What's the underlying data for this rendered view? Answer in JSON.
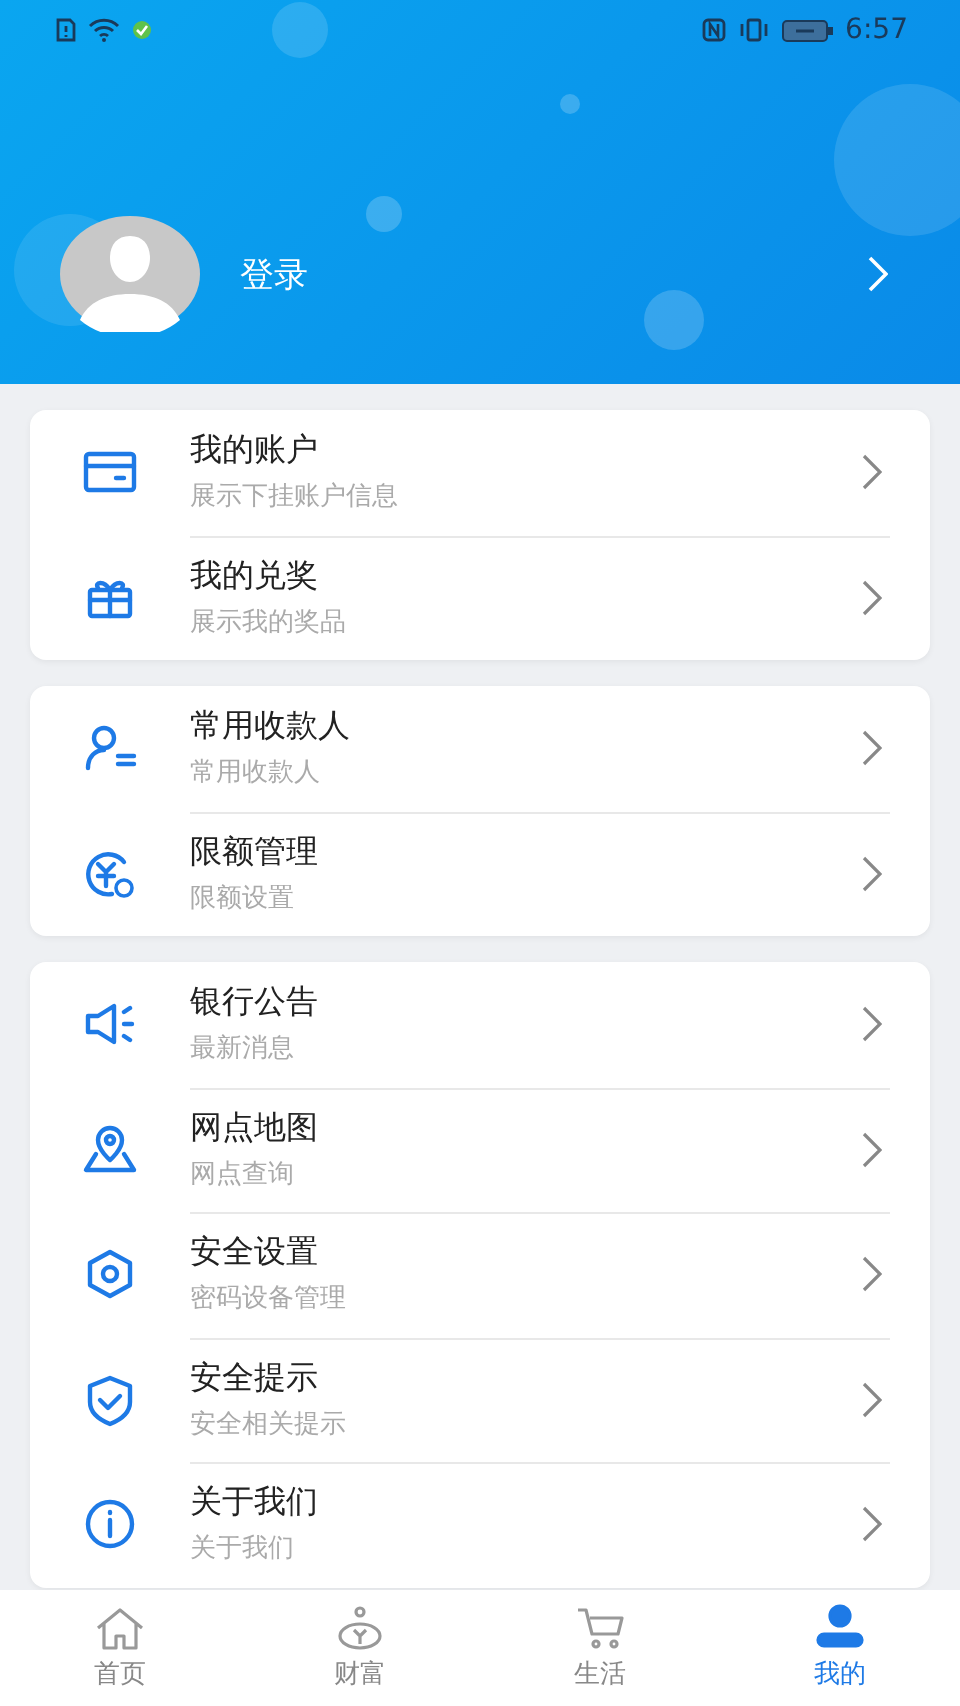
{
  "status_bar": {
    "time": "6:57"
  },
  "profile": {
    "login_label": "登录"
  },
  "groups": [
    {
      "items": [
        {
          "kind": "card",
          "title": "我的账户",
          "subtitle": "展示下挂账户信息"
        },
        {
          "kind": "gift",
          "title": "我的兑奖",
          "subtitle": "展示我的奖品"
        }
      ]
    },
    {
      "items": [
        {
          "kind": "payee",
          "title": "常用收款人",
          "subtitle": "常用收款人"
        },
        {
          "kind": "limit",
          "title": "限额管理",
          "subtitle": "限额设置"
        }
      ]
    },
    {
      "items": [
        {
          "kind": "megaphone",
          "title": "银行公告",
          "subtitle": "最新消息"
        },
        {
          "kind": "map",
          "title": "网点地图",
          "subtitle": "网点查询"
        },
        {
          "kind": "hexagon",
          "title": "安全设置",
          "subtitle": "密码设备管理"
        },
        {
          "kind": "shield",
          "title": "安全提示",
          "subtitle": "安全相关提示"
        },
        {
          "kind": "info",
          "title": "关于我们",
          "subtitle": "关于我们"
        }
      ]
    }
  ],
  "tab_bar": [
    {
      "kind": "home",
      "label": "首页",
      "selected": false
    },
    {
      "kind": "wealth",
      "label": "财富",
      "selected": false
    },
    {
      "kind": "cart",
      "label": "生活",
      "selected": false
    },
    {
      "kind": "person",
      "label": "我的",
      "selected": true
    }
  ]
}
